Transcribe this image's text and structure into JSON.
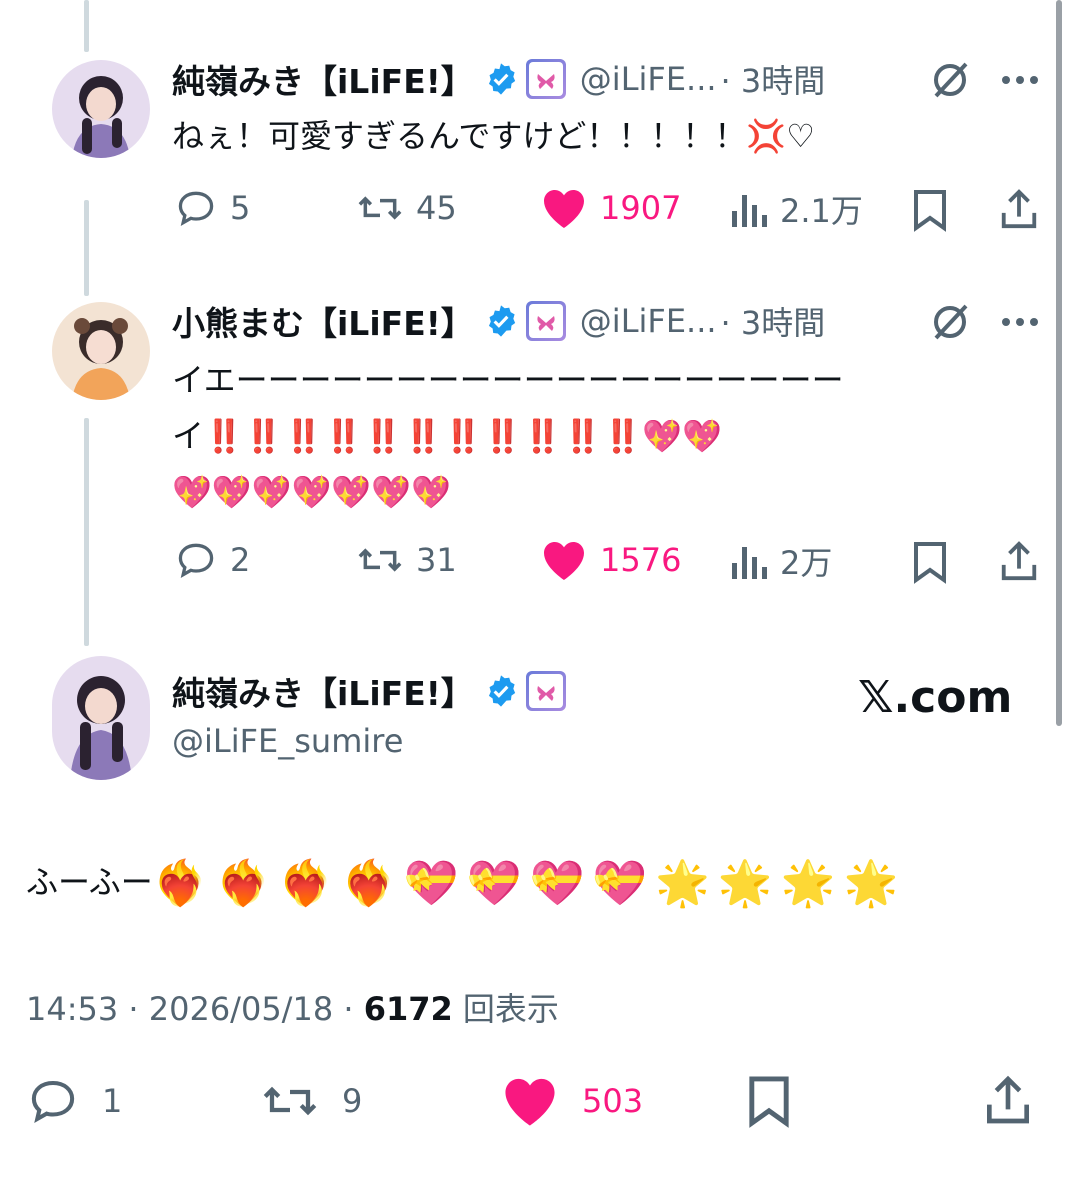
{
  "tweets": [
    {
      "name": "純嶺みき【iLiFE!】",
      "handle": "@iLiFE...",
      "time": "· 3時間",
      "text": "ねぇ！可愛すぎるんですけど！！！！！💢♡",
      "replies": "5",
      "retweets": "45",
      "likes": "1907",
      "views": "2.1万"
    },
    {
      "name": "小熊まむ【iLiFE!】",
      "handle": "@iLiFE...",
      "time": "· 3時間",
      "text_line1": "イエーーーーーーーーーーーーーーーーーーー",
      "text_line2": "イ‼️‼️‼️‼️‼️‼️‼️‼️‼️‼️‼️💖💖",
      "text_line3": "💖💖💖💖💖💖💖",
      "replies": "2",
      "retweets": "31",
      "likes": "1576",
      "views": "2万"
    }
  ],
  "main": {
    "name": "純嶺みき【iLiFE!】",
    "handle": "@iLiFE_sumire",
    "text_prefix": "ふーふー",
    "emoji": [
      "❤️‍🔥",
      "❤️‍🔥",
      "❤️‍🔥",
      "❤️‍🔥",
      "💝",
      "💝",
      "💝",
      "💝",
      "🌟",
      "🌟",
      "🌟",
      "🌟"
    ],
    "time": "14:53 · 2026/05/18 · ",
    "views_count": "6172",
    "views_label": " 回表示",
    "replies": "1",
    "retweets": "9",
    "likes": "503"
  },
  "watermark": "𝕏.com",
  "colors": {
    "like": "#f91880",
    "muted": "#536471",
    "verified": "#1d9bf0",
    "thread_line": "#cfd9de"
  },
  "icons": [
    "reply-icon",
    "retweet-icon",
    "like-icon",
    "views-icon",
    "bookmark-icon",
    "share-icon",
    "grok-icon",
    "more-icon",
    "verified-icon"
  ]
}
